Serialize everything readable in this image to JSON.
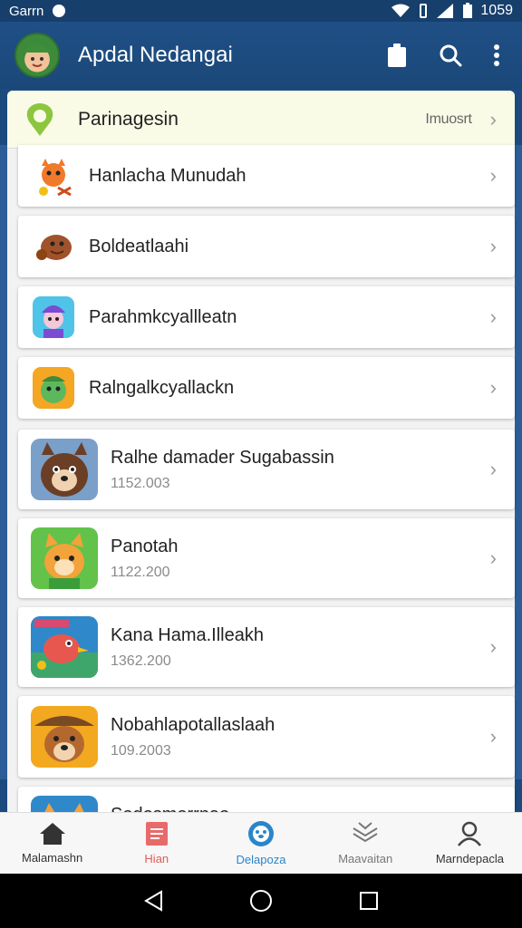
{
  "status": {
    "carrier": "Garrn",
    "time": "1059"
  },
  "app": {
    "title": "Apdal Nedangai"
  },
  "header": {
    "label": "Parinagesin",
    "action": "Imuosrt"
  },
  "rows": [
    {
      "title": "Hanlacha Munudah"
    },
    {
      "title": "Boldeatlaahi"
    },
    {
      "title": "Parahmkcyallleatn"
    },
    {
      "title": "Ralngalkcyallackn"
    },
    {
      "title": "Ralhe damader Sugabassin",
      "sub": "1152.003"
    },
    {
      "title": "Panotah",
      "sub": "1122.200"
    },
    {
      "title": "Kana Hama.Illeakh",
      "sub": "1362.200"
    },
    {
      "title": "Nobahlapotallaslaah",
      "sub": "109.2003"
    },
    {
      "title": "Sodosmorrnao"
    }
  ],
  "nav": [
    {
      "label": "Malamashn",
      "icon": "home-icon"
    },
    {
      "label": "Hian",
      "icon": "document-icon"
    },
    {
      "label": "Delapoza",
      "icon": "paw-icon"
    },
    {
      "label": "Maavaitan",
      "icon": "layers-icon"
    },
    {
      "label": "Marndepacla",
      "icon": "person-icon"
    }
  ],
  "colors": {
    "appbar": "#1f4f86",
    "accent": "#45d1c9",
    "active_nav": "#2a86c9",
    "alt_nav": "#e05a5a"
  }
}
